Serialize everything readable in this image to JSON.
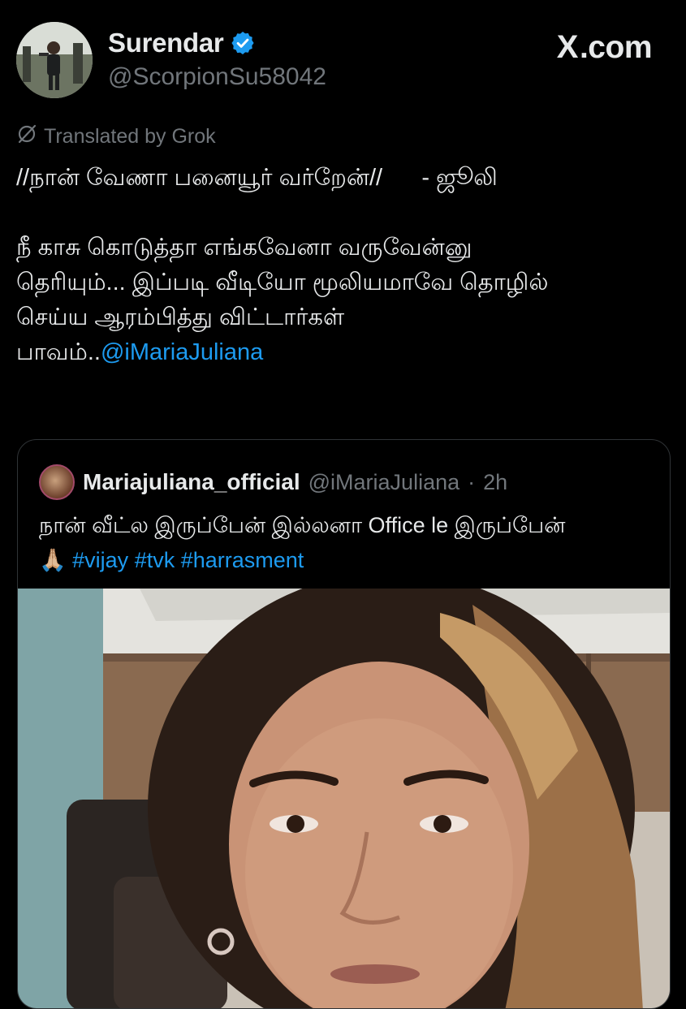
{
  "author": {
    "display_name": "Surendar",
    "handle": "@ScorpionSu58042",
    "verified": true
  },
  "source": {
    "logo_text": ".com",
    "logo_mark": "X"
  },
  "translation": {
    "label": "Translated by Grok"
  },
  "post": {
    "line1": "//நான் வேணா பனையூர் வர்றேன்//      - ஜூலி",
    "line2": "நீ காசு கொடுத்தா எங்கவேனா வருவேன்னு",
    "line3": "தெரியும்... இப்படி வீடியோ மூலியமாவே தொழில்",
    "line4": "செய்ய ஆரம்பித்து விட்டார்கள்",
    "line5_prefix": "பாவம்..",
    "mention": "@iMariaJuliana"
  },
  "quoted": {
    "display_name": "Mariajuliana_official",
    "handle": "@iMariaJuliana",
    "separator": "·",
    "time": "2h",
    "text_line1": "நான் வீட்ல இருப்பேன் இல்லனா Office le இருப்பேன்",
    "emoji": "🙏🏼",
    "hashtags": [
      "#vijay",
      "#tvk",
      "#harrasment"
    ]
  },
  "colors": {
    "background": "#000000",
    "text": "#e7e9ea",
    "muted": "#71767b",
    "link": "#1d9bf0",
    "verified": "#1d9bf0",
    "border": "#2f3336"
  },
  "icons": {
    "verified": "verified-badge-icon",
    "translate": "grok-slash-icon",
    "logo": "x-logo-icon"
  }
}
